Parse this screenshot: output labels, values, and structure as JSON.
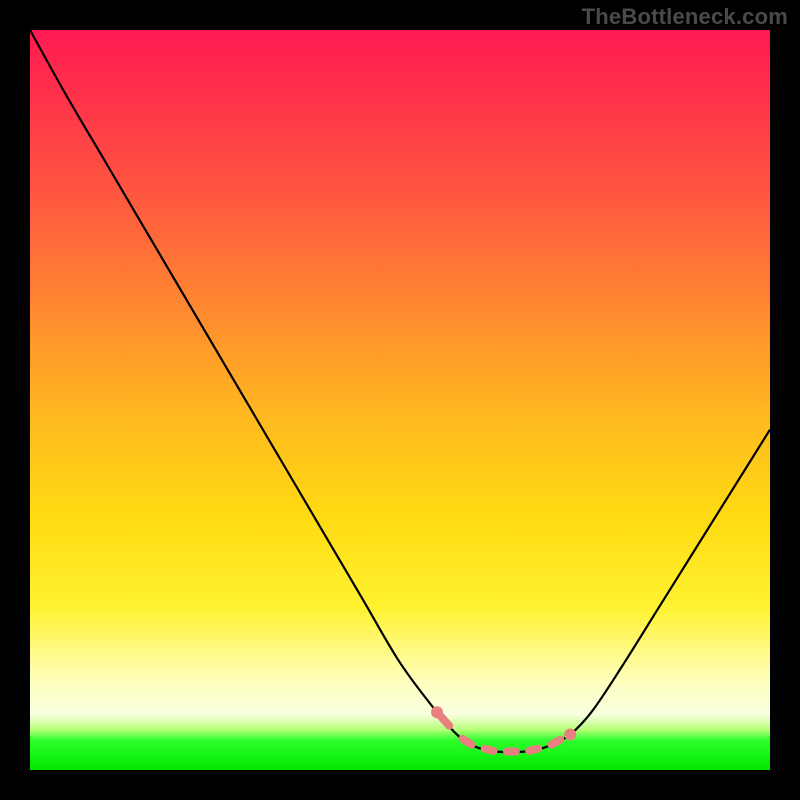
{
  "watermark": "TheBottleneck.com",
  "chart_data": {
    "type": "line",
    "title": "",
    "xlabel": "",
    "ylabel": "",
    "xlim": [
      0,
      100
    ],
    "ylim": [
      0,
      100
    ],
    "grid": false,
    "legend": false,
    "annotations": [],
    "series": [
      {
        "name": "bottleneck-curve",
        "color": "#000000",
        "x": [
          0,
          5,
          10,
          15,
          20,
          25,
          30,
          35,
          40,
          45,
          50,
          55,
          58,
          60,
          63,
          67,
          70,
          73,
          76,
          80,
          85,
          90,
          95,
          100
        ],
        "values": [
          100,
          91,
          82.5,
          74,
          65.5,
          57,
          48.5,
          40,
          31.5,
          23,
          14.5,
          7.8,
          4.5,
          3.2,
          2.5,
          2.5,
          3.2,
          4.8,
          8.0,
          14,
          22,
          30,
          38,
          46
        ]
      }
    ],
    "highlight_range_x": [
      55,
      73
    ],
    "highlight_color": "#e98080",
    "background_gradient_meaning": "red=high bottleneck, green=low bottleneck"
  }
}
